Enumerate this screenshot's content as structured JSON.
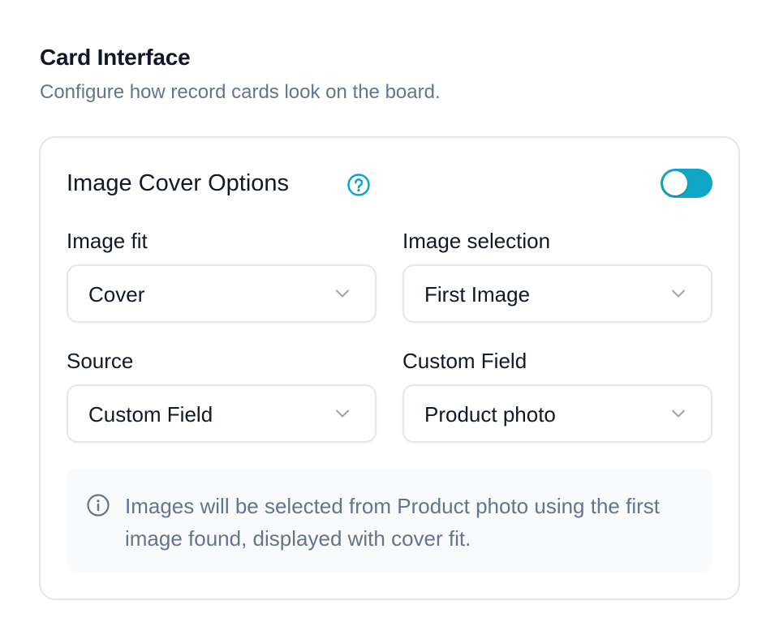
{
  "header": {
    "title": "Card Interface",
    "subtitle": "Configure how record cards look on the board."
  },
  "section": {
    "title": "Image Cover Options",
    "help_icon": "question-circle-icon",
    "toggle_on": true,
    "accent_color": "#0ea5c6"
  },
  "fields": {
    "image_fit": {
      "label": "Image fit",
      "value": "Cover"
    },
    "image_selection": {
      "label": "Image selection",
      "value": "First Image"
    },
    "source": {
      "label": "Source",
      "value": "Custom Field"
    },
    "custom_field": {
      "label": "Custom Field",
      "value": "Product photo"
    }
  },
  "info": {
    "icon": "info-circle-icon",
    "text": "Images will be selected from Product photo using the first image found, displayed with cover fit."
  }
}
